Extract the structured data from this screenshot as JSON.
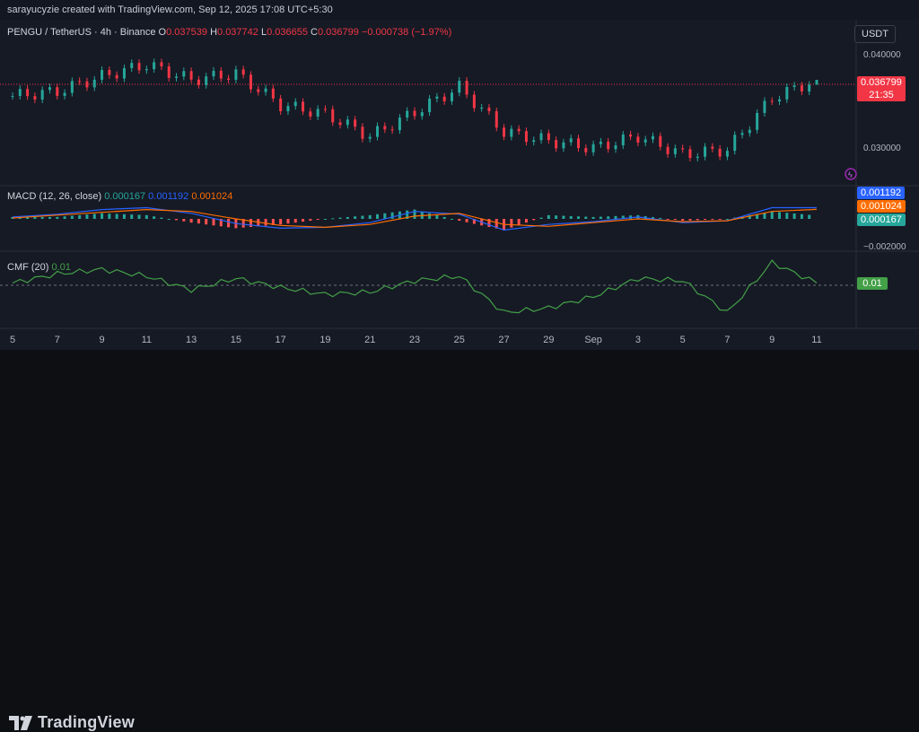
{
  "header": {
    "attribution": "sarayucyzie created with TradingView.com, Sep 12, 2025 17:08 UTC+5:30"
  },
  "symbol": {
    "title": "PENGU / TetherUS · 4h · Binance",
    "o_label": "O",
    "o": "0.037539",
    "h_label": "H",
    "h": "0.037742",
    "l_label": "L",
    "l": "0.036655",
    "c_label": "C",
    "c": "0.036799",
    "change": "−0.000738 (−1.97%)"
  },
  "currency_button": "USDT",
  "price_axis": {
    "ticks": [
      "0.040000",
      "0.030000"
    ]
  },
  "last_price": {
    "value": "0.036799",
    "countdown": "21:35"
  },
  "macd": {
    "label": "MACD (12, 26, close)",
    "hist": "0.000167",
    "macd": "0.001192",
    "signal": "0.001024",
    "axis_ticks": [
      "−0.002000"
    ],
    "tags": [
      "0.001192",
      "0.001024",
      "0.000167"
    ]
  },
  "cmf": {
    "label": "CMF (20)",
    "value": "0.01",
    "tag": "0.01"
  },
  "time_axis": [
    "5",
    "7",
    "9",
    "11",
    "13",
    "15",
    "17",
    "19",
    "21",
    "23",
    "25",
    "27",
    "29",
    "Sep",
    "3",
    "5",
    "7",
    "9",
    "11"
  ],
  "brand": {
    "name": "TradingView"
  },
  "colors": {
    "up": "#26a69a",
    "down": "#f23645",
    "macd": "#2962ff",
    "signal": "#ff6d00",
    "cmf": "#43a047",
    "last_price": "#f23645"
  },
  "chart_data": [
    {
      "type": "candlestick",
      "title": "PENGU / TetherUS · 4h · Binance",
      "x": [
        "5",
        "7",
        "9",
        "11",
        "13",
        "15",
        "17",
        "19",
        "21",
        "23",
        "25",
        "27",
        "29",
        "Sep",
        "3",
        "5",
        "7",
        "9",
        "11"
      ],
      "close": [
        0.035,
        0.0355,
        0.0372,
        0.0385,
        0.0368,
        0.0375,
        0.034,
        0.033,
        0.0305,
        0.0332,
        0.036,
        0.031,
        0.03,
        0.0292,
        0.0305,
        0.0285,
        0.029,
        0.0348,
        0.0368
      ],
      "last_close": 0.036799,
      "ylim": [
        0.0265,
        0.0415
      ],
      "y_ticks": [
        0.04,
        0.03
      ]
    },
    {
      "type": "line",
      "title": "MACD (12, 26, close)",
      "series": [
        {
          "name": "MACD",
          "values": [
            0.0002,
            0.0005,
            0.001,
            0.0012,
            0.0006,
            -0.0005,
            -0.001,
            -0.0009,
            -0.0004,
            0.0008,
            0.0005,
            -0.0012,
            -0.0006,
            -0.0003,
            0.0002,
            -0.0004,
            -0.0002,
            0.0012,
            0.0012
          ]
        },
        {
          "name": "Signal",
          "values": [
            0.0001,
            0.0004,
            0.0007,
            0.001,
            0.0008,
            0.0,
            -0.0007,
            -0.0009,
            -0.0006,
            0.0003,
            0.0006,
            -0.0006,
            -0.0008,
            -0.0004,
            0.0,
            -0.0003,
            -0.0002,
            0.0008,
            0.00102
          ]
        }
      ],
      "ylim": [
        -0.0025,
        0.0025
      ]
    },
    {
      "type": "line",
      "title": "CMF (20)",
      "series": [
        {
          "name": "CMF",
          "values": [
            0.01,
            0.05,
            0.07,
            0.04,
            -0.02,
            0.03,
            -0.01,
            -0.04,
            -0.03,
            0.02,
            0.04,
            -0.12,
            -0.1,
            -0.05,
            0.03,
            0.02,
            -0.12,
            0.1,
            0.01
          ]
        }
      ],
      "ylim": [
        -0.15,
        0.15
      ]
    }
  ]
}
